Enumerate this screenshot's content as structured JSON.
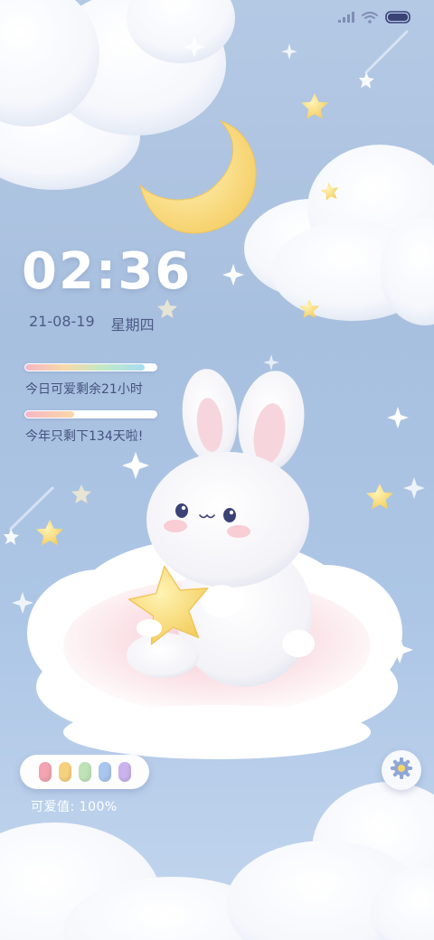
{
  "status_bar": {
    "signal_icon": "cellular-signal-icon",
    "wifi_icon": "wifi-icon",
    "battery_icon": "battery-icon"
  },
  "clock": {
    "time": "02:36",
    "date": "21-08-19",
    "weekday": "星期四"
  },
  "progress": [
    {
      "label": "今日可爱剩余21小时",
      "fraction": 0.91,
      "colors": [
        "#f6b6c6",
        "#f7d9a8",
        "#bfe9c8",
        "#a7dcf2"
      ]
    },
    {
      "label": "今年只剩下134天啦!",
      "fraction": 0.37,
      "colors": [
        "#f6b6c6",
        "#f9d8a4"
      ]
    }
  ],
  "mood": {
    "beans": [
      "#f3a3b1",
      "#f7d27e",
      "#bfe3b7",
      "#a9c6ef",
      "#c9b3ec"
    ],
    "label": "可爱值: 100%"
  },
  "settings": {
    "icon": "gear-icon"
  },
  "scene": {
    "character": "bunny-on-cloud",
    "moon": "crescent-moon",
    "accent": "#f8d66d"
  }
}
